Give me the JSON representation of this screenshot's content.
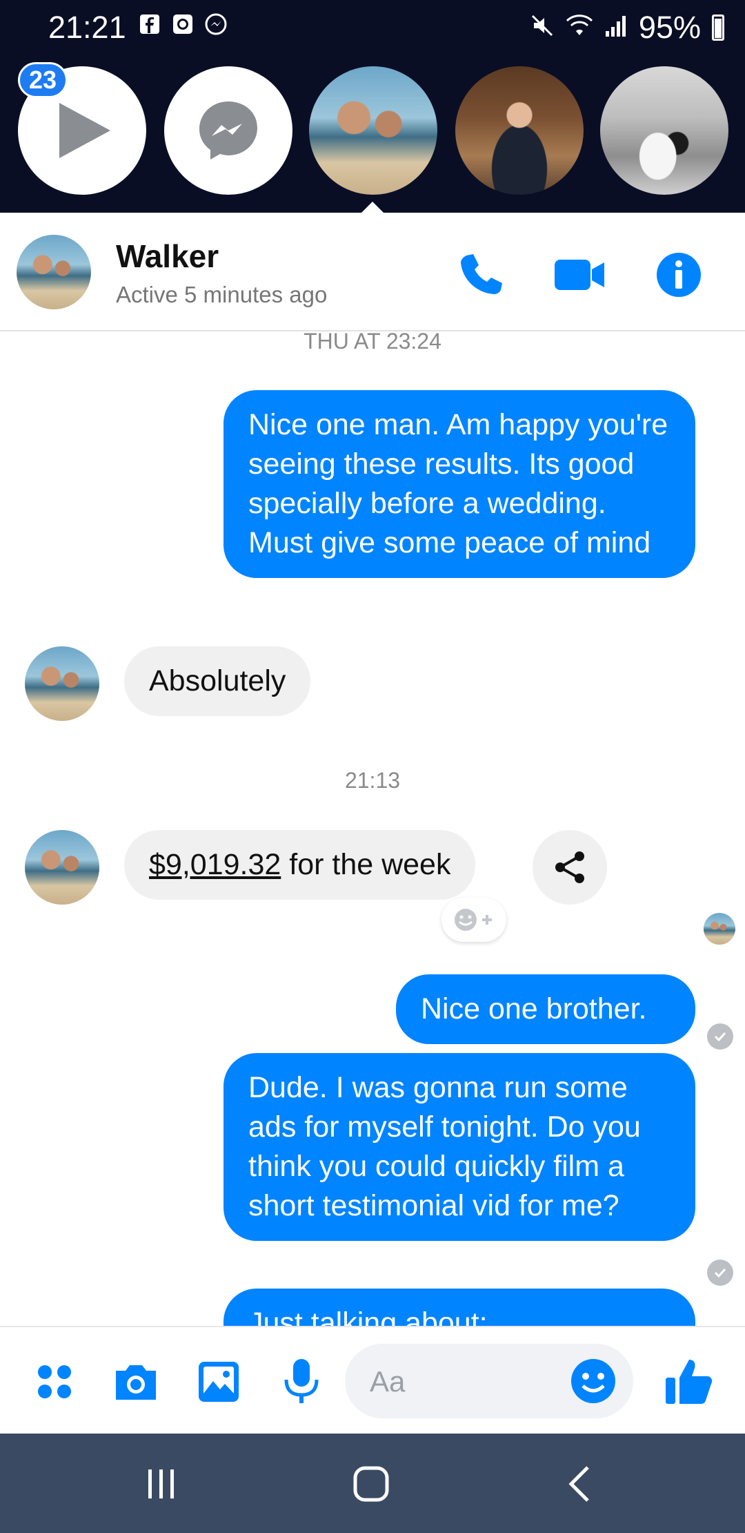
{
  "status_bar": {
    "time": "21:21",
    "battery": "95%",
    "left_icons": [
      "facebook-icon",
      "clock-app-icon",
      "messenger-notification-icon"
    ],
    "right_icons": [
      "mute-icon",
      "wifi-icon",
      "signal-icon",
      "battery-icon"
    ]
  },
  "chat_heads": {
    "badge_count": "23",
    "items": [
      {
        "name": "play-chat-head",
        "icon": "play-icon"
      },
      {
        "name": "messenger-chat-head",
        "icon": "messenger-icon"
      },
      {
        "name": "walker-chat-head",
        "photo": "beach"
      },
      {
        "name": "office-man-chat-head",
        "photo": "office"
      },
      {
        "name": "wedding-chat-head",
        "photo": "wedding"
      }
    ]
  },
  "header": {
    "name": "Walker",
    "status": "Active 5 minutes ago",
    "actions": [
      "phone-icon",
      "video-camera-icon",
      "info-icon"
    ]
  },
  "messages": {
    "timestamp_1": "THU AT 23:24",
    "out_1": "Nice one man. Am happy you're seeing these results. Its good specially before a wedding. Must give some peace of mind",
    "in_1": "Absolutely",
    "timestamp_2": "21:13",
    "in_2_amount": "$9,019.32",
    "in_2_rest": " for the week",
    "out_2": "Nice one brother.",
    "out_3": "Dude. I was gonna run some ads for myself tonight. Do you think you could quickly film a short testimonial vid for me?",
    "out_4_partial": "Just talking about:"
  },
  "composer": {
    "placeholder": "Aa",
    "icons": [
      "menu-dots-icon",
      "camera-icon",
      "gallery-icon",
      "microphone-icon",
      "emoji-icon",
      "thumbs-up-icon"
    ]
  },
  "colors": {
    "accent": "#0084ff",
    "top_background": "#0a0e25",
    "navbar": "#3b4a63"
  }
}
